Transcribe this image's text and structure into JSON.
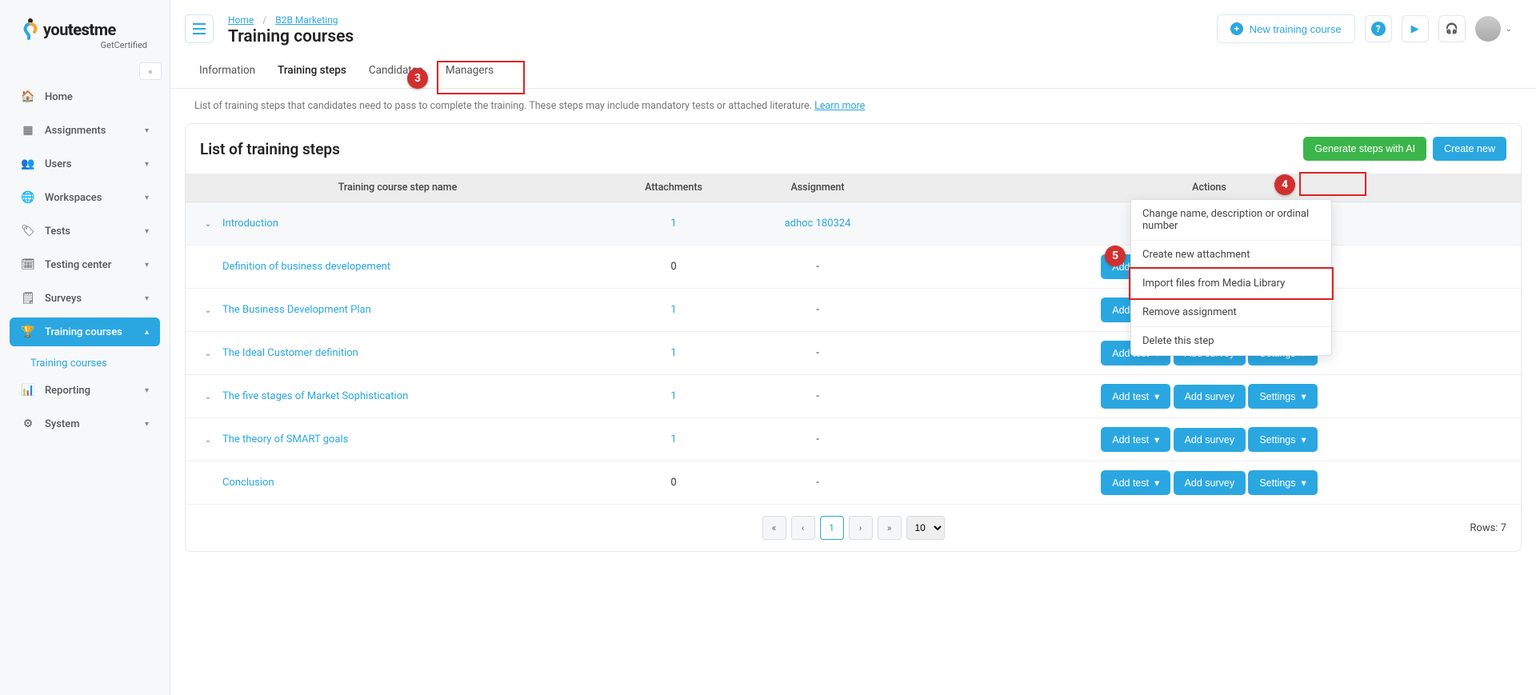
{
  "logo": {
    "brand_prefix": "you",
    "brand_mid": "test",
    "brand_suffix": "me",
    "subline": "GetCertified"
  },
  "sidebar": {
    "items": [
      {
        "icon": "home-icon",
        "label": "Home"
      },
      {
        "icon": "assignments-icon",
        "label": "Assignments"
      },
      {
        "icon": "users-icon",
        "label": "Users"
      },
      {
        "icon": "workspaces-icon",
        "label": "Workspaces"
      },
      {
        "icon": "tests-icon",
        "label": "Tests"
      },
      {
        "icon": "testing-center-icon",
        "label": "Testing center"
      },
      {
        "icon": "surveys-icon",
        "label": "Surveys"
      },
      {
        "icon": "training-courses-icon",
        "label": "Training courses"
      },
      {
        "icon": "reporting-icon",
        "label": "Reporting"
      },
      {
        "icon": "system-icon",
        "label": "System"
      }
    ],
    "sub_training": "Training courses"
  },
  "breadcrumb": {
    "home": "Home",
    "sep": "/",
    "section": "B2B Marketing"
  },
  "page_title": "Training courses",
  "top": {
    "new_course": "New training course"
  },
  "tabs": [
    "Information",
    "Training steps",
    "Candidates",
    "Managers"
  ],
  "description": {
    "text": "List of training steps that candidates need to pass to complete the training. These steps may include mandatory tests or attached literature. ",
    "link": "Learn more"
  },
  "panel": {
    "title": "List of training steps",
    "generate_ai": "Generate steps with AI",
    "create_new": "Create new"
  },
  "columns": {
    "name": "Training course step name",
    "attachments": "Attachments",
    "assignment": "Assignment",
    "actions": "Actions"
  },
  "rows": [
    {
      "expandable": true,
      "name": "Introduction",
      "attachments": "1",
      "assignment": "adhoc 180324",
      "settings_open": true
    },
    {
      "expandable": false,
      "name": "Definition of business developement",
      "attachments": "0",
      "assignment": "-"
    },
    {
      "expandable": true,
      "name": "The Business Development Plan",
      "attachments": "1",
      "assignment": "-"
    },
    {
      "expandable": true,
      "name": "The Ideal Customer definition",
      "attachments": "1",
      "assignment": "-"
    },
    {
      "expandable": true,
      "name": "The five stages of Market Sophistication",
      "attachments": "1",
      "assignment": "-"
    },
    {
      "expandable": true,
      "name": "The theory of SMART goals",
      "attachments": "1",
      "assignment": "-"
    },
    {
      "expandable": false,
      "name": "Conclusion",
      "attachments": "0",
      "assignment": "-"
    }
  ],
  "action_labels": {
    "add_test": "Add test",
    "add_survey": "Add survey",
    "settings": "Settings"
  },
  "dropdown": {
    "change": "Change name, description or ordinal number",
    "create_attachment": "Create new attachment",
    "import": "Import files from Media Library",
    "remove_assignment": "Remove assignment",
    "delete": "Delete this step"
  },
  "pager": {
    "page": "1",
    "page_size": "10",
    "rows_label": "Rows: 7"
  },
  "callouts": {
    "c3": "3",
    "c4": "4",
    "c5": "5"
  }
}
